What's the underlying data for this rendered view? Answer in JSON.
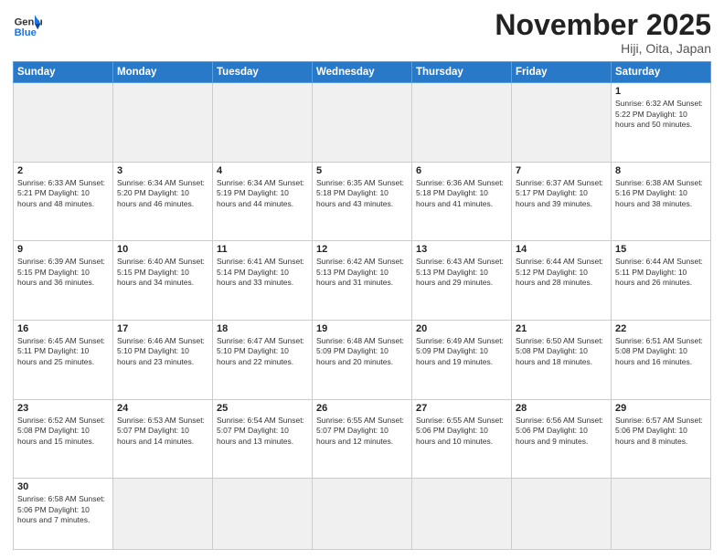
{
  "header": {
    "logo_general": "General",
    "logo_blue": "Blue",
    "month_title": "November 2025",
    "location": "Hiji, Oita, Japan"
  },
  "days_of_week": [
    "Sunday",
    "Monday",
    "Tuesday",
    "Wednesday",
    "Thursday",
    "Friday",
    "Saturday"
  ],
  "weeks": [
    [
      {
        "day": "",
        "info": "",
        "empty": true
      },
      {
        "day": "",
        "info": "",
        "empty": true
      },
      {
        "day": "",
        "info": "",
        "empty": true
      },
      {
        "day": "",
        "info": "",
        "empty": true
      },
      {
        "day": "",
        "info": "",
        "empty": true
      },
      {
        "day": "",
        "info": "",
        "empty": true
      },
      {
        "day": "1",
        "info": "Sunrise: 6:32 AM\nSunset: 5:22 PM\nDaylight: 10 hours\nand 50 minutes."
      }
    ],
    [
      {
        "day": "2",
        "info": "Sunrise: 6:33 AM\nSunset: 5:21 PM\nDaylight: 10 hours\nand 48 minutes."
      },
      {
        "day": "3",
        "info": "Sunrise: 6:34 AM\nSunset: 5:20 PM\nDaylight: 10 hours\nand 46 minutes."
      },
      {
        "day": "4",
        "info": "Sunrise: 6:34 AM\nSunset: 5:19 PM\nDaylight: 10 hours\nand 44 minutes."
      },
      {
        "day": "5",
        "info": "Sunrise: 6:35 AM\nSunset: 5:18 PM\nDaylight: 10 hours\nand 43 minutes."
      },
      {
        "day": "6",
        "info": "Sunrise: 6:36 AM\nSunset: 5:18 PM\nDaylight: 10 hours\nand 41 minutes."
      },
      {
        "day": "7",
        "info": "Sunrise: 6:37 AM\nSunset: 5:17 PM\nDaylight: 10 hours\nand 39 minutes."
      },
      {
        "day": "8",
        "info": "Sunrise: 6:38 AM\nSunset: 5:16 PM\nDaylight: 10 hours\nand 38 minutes."
      }
    ],
    [
      {
        "day": "9",
        "info": "Sunrise: 6:39 AM\nSunset: 5:15 PM\nDaylight: 10 hours\nand 36 minutes."
      },
      {
        "day": "10",
        "info": "Sunrise: 6:40 AM\nSunset: 5:15 PM\nDaylight: 10 hours\nand 34 minutes."
      },
      {
        "day": "11",
        "info": "Sunrise: 6:41 AM\nSunset: 5:14 PM\nDaylight: 10 hours\nand 33 minutes."
      },
      {
        "day": "12",
        "info": "Sunrise: 6:42 AM\nSunset: 5:13 PM\nDaylight: 10 hours\nand 31 minutes."
      },
      {
        "day": "13",
        "info": "Sunrise: 6:43 AM\nSunset: 5:13 PM\nDaylight: 10 hours\nand 29 minutes."
      },
      {
        "day": "14",
        "info": "Sunrise: 6:44 AM\nSunset: 5:12 PM\nDaylight: 10 hours\nand 28 minutes."
      },
      {
        "day": "15",
        "info": "Sunrise: 6:44 AM\nSunset: 5:11 PM\nDaylight: 10 hours\nand 26 minutes."
      }
    ],
    [
      {
        "day": "16",
        "info": "Sunrise: 6:45 AM\nSunset: 5:11 PM\nDaylight: 10 hours\nand 25 minutes."
      },
      {
        "day": "17",
        "info": "Sunrise: 6:46 AM\nSunset: 5:10 PM\nDaylight: 10 hours\nand 23 minutes."
      },
      {
        "day": "18",
        "info": "Sunrise: 6:47 AM\nSunset: 5:10 PM\nDaylight: 10 hours\nand 22 minutes."
      },
      {
        "day": "19",
        "info": "Sunrise: 6:48 AM\nSunset: 5:09 PM\nDaylight: 10 hours\nand 20 minutes."
      },
      {
        "day": "20",
        "info": "Sunrise: 6:49 AM\nSunset: 5:09 PM\nDaylight: 10 hours\nand 19 minutes."
      },
      {
        "day": "21",
        "info": "Sunrise: 6:50 AM\nSunset: 5:08 PM\nDaylight: 10 hours\nand 18 minutes."
      },
      {
        "day": "22",
        "info": "Sunrise: 6:51 AM\nSunset: 5:08 PM\nDaylight: 10 hours\nand 16 minutes."
      }
    ],
    [
      {
        "day": "23",
        "info": "Sunrise: 6:52 AM\nSunset: 5:08 PM\nDaylight: 10 hours\nand 15 minutes."
      },
      {
        "day": "24",
        "info": "Sunrise: 6:53 AM\nSunset: 5:07 PM\nDaylight: 10 hours\nand 14 minutes."
      },
      {
        "day": "25",
        "info": "Sunrise: 6:54 AM\nSunset: 5:07 PM\nDaylight: 10 hours\nand 13 minutes."
      },
      {
        "day": "26",
        "info": "Sunrise: 6:55 AM\nSunset: 5:07 PM\nDaylight: 10 hours\nand 12 minutes."
      },
      {
        "day": "27",
        "info": "Sunrise: 6:55 AM\nSunset: 5:06 PM\nDaylight: 10 hours\nand 10 minutes."
      },
      {
        "day": "28",
        "info": "Sunrise: 6:56 AM\nSunset: 5:06 PM\nDaylight: 10 hours\nand 9 minutes."
      },
      {
        "day": "29",
        "info": "Sunrise: 6:57 AM\nSunset: 5:06 PM\nDaylight: 10 hours\nand 8 minutes."
      }
    ],
    [
      {
        "day": "30",
        "info": "Sunrise: 6:58 AM\nSunset: 5:06 PM\nDaylight: 10 hours\nand 7 minutes.",
        "last": true
      },
      {
        "day": "",
        "info": "",
        "empty": true,
        "last": true
      },
      {
        "day": "",
        "info": "",
        "empty": true,
        "last": true
      },
      {
        "day": "",
        "info": "",
        "empty": true,
        "last": true
      },
      {
        "day": "",
        "info": "",
        "empty": true,
        "last": true
      },
      {
        "day": "",
        "info": "",
        "empty": true,
        "last": true
      },
      {
        "day": "",
        "info": "",
        "empty": true,
        "last": true
      }
    ]
  ]
}
